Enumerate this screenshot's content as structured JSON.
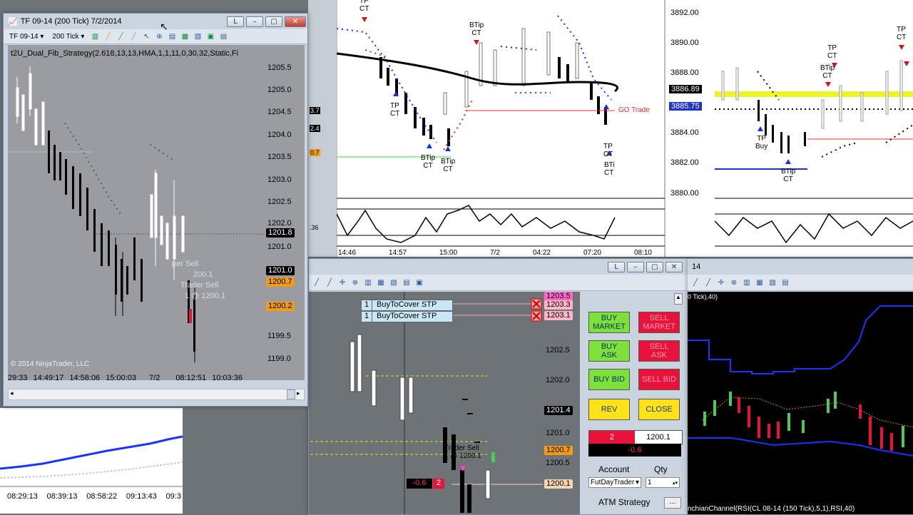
{
  "main_window": {
    "title": "TF 09-14 (200 Tick)  7/2/2014",
    "instrument": "TF 09-14",
    "interval": "200 Tick",
    "strategy_label": "t2U_Dual_Fib_Strategy(2.618,13,13,HMA,1,1,11,0,30,32,Static,Fi",
    "copyright": "© 2014 NinjaTrader, LLC",
    "price_axis": [
      "1205.5",
      "1205.0",
      "1204.5",
      "1204.0",
      "1203.5",
      "1203.0",
      "1202.5",
      "1202.0",
      "1201.5",
      "1201.0",
      "1200.5",
      "1200.0",
      "1199.5",
      "1199.0"
    ],
    "time_axis": [
      "29:33",
      "14:49:17",
      "14:58:06",
      "15:00:03",
      "7/2",
      "08:12:51",
      "10:03:36"
    ],
    "price_tags": [
      {
        "label": "1201.8",
        "color": "#000000",
        "text": "#ffffff"
      },
      {
        "label": "1201.0",
        "color": "#000000",
        "text": "#ffffff"
      },
      {
        "label": "1200.7",
        "color": "#f39c12",
        "text": "#000000"
      },
      {
        "label": "1200.2",
        "color": "#f39c12",
        "text": "#000000"
      }
    ],
    "annotations": [
      "per Sell",
      "200.1",
      "Trader Sell",
      "1 @ 1200.1"
    ]
  },
  "left_partial_tags": [
    "3.7",
    "2.4",
    "0.7",
    ".36"
  ],
  "top_center_chart": {
    "price_axis": [
      "3892.00",
      "3890.00",
      "3888.00",
      "3886.89",
      "3885.75",
      "3884.00",
      "3882.00",
      "3880.00"
    ],
    "tag_current": "3886.89",
    "tag_blue": "3885.75",
    "go_trade": "GO Trade",
    "time_axis": [
      "14:46",
      "14:57",
      "15:00",
      "7/2",
      "04:22",
      "07:20",
      "08:10"
    ],
    "labels": [
      "TP",
      "CT",
      "BTip",
      "CT",
      "TP",
      "CT",
      "BTip",
      "CT",
      "BTip",
      "CT",
      "TP",
      "CT",
      "BTi",
      "CT"
    ]
  },
  "top_right_chart": {
    "labels": [
      "TP",
      "CT",
      "BTip",
      "CT",
      "TP",
      "CT",
      "TP",
      "Buy",
      "BTip",
      "CT"
    ]
  },
  "bottom_left_chart": {
    "time_axis": [
      "08:29:13",
      "08:39:13",
      "08:58:22",
      "09:13:43",
      "09:3"
    ]
  },
  "dom_window": {
    "orders": [
      {
        "qty": "1",
        "label": "BuyToCover STP"
      },
      {
        "qty": "1",
        "label": "BuyToCover STP"
      }
    ],
    "price_axis": [
      "1202.5",
      "1202.0",
      "1201.5",
      "1201.0",
      "1200.5"
    ],
    "tags": [
      {
        "label": "1203.5",
        "color": "#ff66cc"
      },
      {
        "label": "1203.3",
        "color": "#ffb6c8"
      },
      {
        "label": "1203.1",
        "color": "#ffb6c8"
      },
      {
        "label": "1201.4",
        "color": "#000000"
      },
      {
        "label": "1200.7",
        "color": "#f39c12"
      },
      {
        "label": "1200.1",
        "color": "#f5d4b0"
      }
    ],
    "trader_sell": "Trader Sell",
    "trader_fill": "1 @ 1200.1",
    "pnl": "-0.6",
    "position": "2",
    "buttons": {
      "buy_market": "BUY\nMARKET",
      "sell_market": "SELL\nMARKET",
      "buy_ask": "BUY\nASK",
      "sell_ask": "SELL\nASK",
      "buy_bid": "BUY BID",
      "sell_bid": "SELL BID",
      "rev": "REV",
      "close": "CLOSE"
    },
    "position_qty": "2",
    "position_price": "1200.1",
    "position_pnl": "-0.6",
    "account_label": "Account",
    "account_value": "FutDayTrader",
    "qty_label": "Qty",
    "qty_value": "1",
    "atm_label": "ATM Strategy",
    "atm_btn": "..."
  },
  "bottom_right_chart": {
    "header": "0 Tick),40)",
    "window_num": "14",
    "footer": "nchianChannel(RSI(CL 08-14 (150 Tick),5,1),RSI,40)"
  },
  "colors": {
    "buy": "#7ee03a",
    "sell": "#e8123a",
    "accent": "#ffe21a"
  }
}
